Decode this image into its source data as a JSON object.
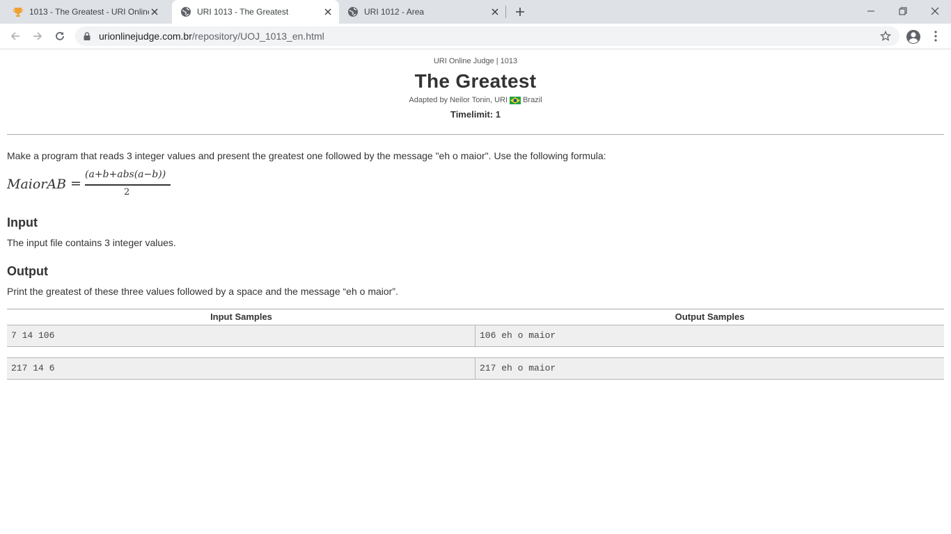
{
  "browser": {
    "tabs": [
      {
        "title": "1013 - The Greatest - URI Online Judge",
        "favicon": "trophy-icon",
        "active": false
      },
      {
        "title": "URI 1013 - The Greatest",
        "favicon": "globe-icon",
        "active": true
      },
      {
        "title": "URI 1012 - Area",
        "favicon": "globe-icon",
        "active": false
      }
    ],
    "url_host": "urionlinejudge.com.br",
    "url_path": "/repository/UOJ_1013_en.html"
  },
  "problem": {
    "breadcrumb": "URI Online Judge | 1013",
    "title": "The Greatest",
    "adapted_by": "Adapted by Neilor Tonin, URI",
    "country": "Brazil",
    "timelimit": "Timelimit: 1",
    "description": "Make a program that reads 3 integer values and present the greatest one followed by the message \"eh o maior\". Use the following formula:",
    "formula": {
      "lhs": "MaiorAB",
      "equals": "=",
      "numerator": "(a+b+abs(a−b))",
      "denominator": "2"
    },
    "input_heading": "Input",
    "input_text": "The input file contains 3 integer values.",
    "output_heading": "Output",
    "output_text": "Print the greatest of these three values followed by a space and the message “eh o maior”."
  },
  "samples": {
    "input_header": "Input Samples",
    "output_header": "Output Samples",
    "rows": [
      {
        "input": "7 14 106",
        "output": "106 eh o maior"
      },
      {
        "input": "217 14 6",
        "output": "217 eh o maior"
      }
    ]
  }
}
